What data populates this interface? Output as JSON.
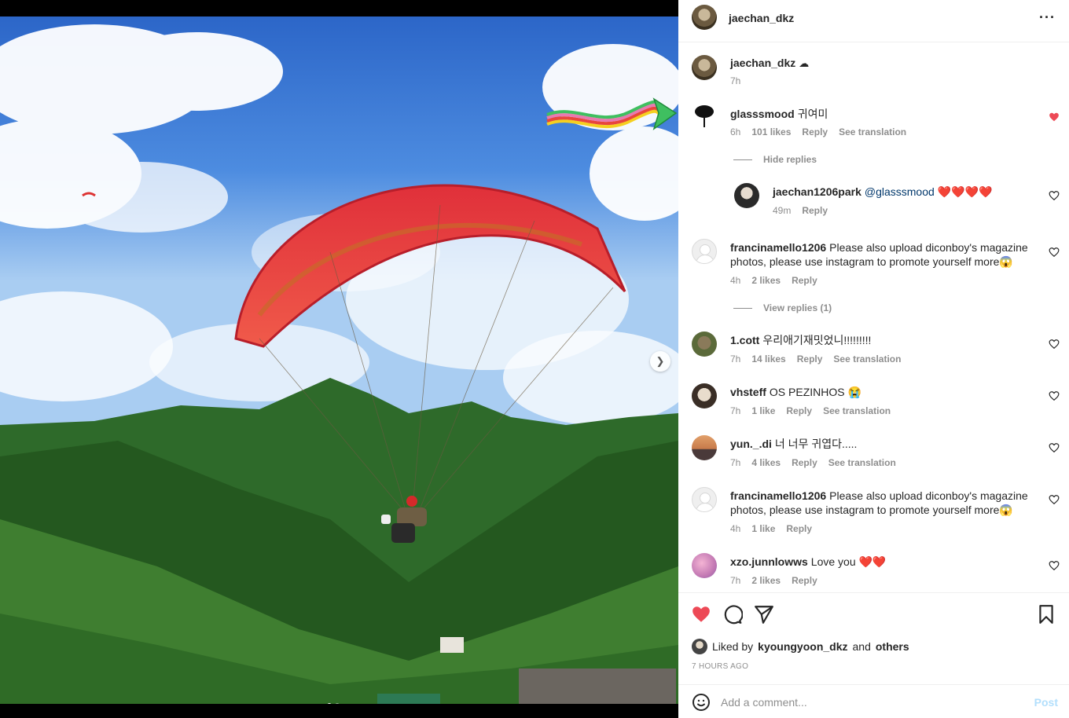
{
  "post": {
    "author": "jaechan_dkz",
    "more_icon": "more-horizontal-icon",
    "caption_username": "jaechan_dkz",
    "caption_emoji": "☁",
    "caption_time": "7h"
  },
  "comments": [
    {
      "username": "glasssmood",
      "text": "귀여미",
      "time": "6h",
      "likes": "101 likes",
      "reply": "Reply",
      "translation": "See translation",
      "liked": true
    },
    {
      "username": "jaechan1206park",
      "text": "@glasssmood ❤️❤️❤️❤️",
      "time": "49m",
      "reply": "Reply",
      "liked": false
    },
    {
      "username": "francinamello1206",
      "text": "Please also upload diconboy's magazine photos, please use instagram to promote yourself more😱",
      "time": "4h",
      "likes": "2 likes",
      "reply": "Reply",
      "liked": false
    },
    {
      "username": "1.cott",
      "text": "우리애기재밋었니!!!!!!!!!",
      "time": "7h",
      "likes": "14 likes",
      "reply": "Reply",
      "translation": "See translation",
      "liked": false
    },
    {
      "username": "vhsteff",
      "text": "OS PEZINHOS 😭",
      "time": "7h",
      "likes": "1 like",
      "reply": "Reply",
      "translation": "See translation",
      "liked": false
    },
    {
      "username": "yun._.di",
      "text": "너 너무 귀엽다.....",
      "time": "7h",
      "likes": "4 likes",
      "reply": "Reply",
      "translation": "See translation",
      "liked": false
    },
    {
      "username": "francinamello1206",
      "text": "Please also upload diconboy's magazine photos, please use instagram to promote yourself more😱",
      "time": "4h",
      "likes": "1 like",
      "reply": "Reply",
      "liked": false
    },
    {
      "username": "xzo.junnlowws",
      "text": "Love you ❤️❤️",
      "time": "7h",
      "likes": "2 likes",
      "reply": "Reply",
      "liked": false
    }
  ],
  "reply_toggles": {
    "hide": "Hide replies",
    "view": "View replies (1)"
  },
  "actions": {
    "like_icon": "heart-filled-icon",
    "comment_icon": "comment-bubble-icon",
    "share_icon": "paper-plane-icon",
    "save_icon": "bookmark-icon"
  },
  "liked_by": {
    "prefix": "Liked by",
    "user": "kyoungyoon_dkz",
    "middle": "and",
    "others": "others"
  },
  "timestamp": "7 HOURS AGO",
  "add_comment": {
    "placeholder": "Add a comment...",
    "post_label": "Post",
    "emoji_icon": "smiley-icon"
  },
  "colors": {
    "like_red": "#ed4956",
    "post_blue_disabled": "#b2dffc",
    "secondary_text": "#8e8e8e"
  }
}
